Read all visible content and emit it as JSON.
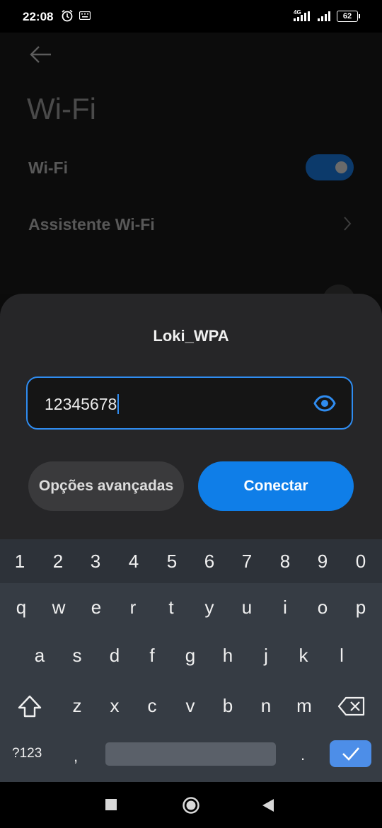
{
  "status_bar": {
    "time": "22:08",
    "network": "4G",
    "battery": "62",
    "icons": [
      "alarm-icon",
      "keyboard-icon",
      "signal-icon",
      "signal-icon",
      "battery-icon"
    ]
  },
  "settings": {
    "title": "Wi-Fi",
    "wifi_label": "Wi-Fi",
    "wifi_enabled": true,
    "assistant_label": "Assistente Wi-Fi"
  },
  "dialog": {
    "network_name": "Loki_WPA",
    "password_value": "12345678",
    "advanced_label": "Opções avançadas",
    "connect_label": "Conectar"
  },
  "keyboard": {
    "numbers": [
      "1",
      "2",
      "3",
      "4",
      "5",
      "6",
      "7",
      "8",
      "9",
      "0"
    ],
    "row1": [
      "q",
      "w",
      "e",
      "r",
      "t",
      "y",
      "u",
      "i",
      "o",
      "p"
    ],
    "row2": [
      "a",
      "s",
      "d",
      "f",
      "g",
      "h",
      "j",
      "k",
      "l"
    ],
    "row3": [
      "z",
      "x",
      "c",
      "v",
      "b",
      "n",
      "m"
    ],
    "symbols_label": "?123",
    "comma": ",",
    "period": "."
  },
  "nav": {
    "icons": [
      "recents-icon",
      "home-icon",
      "back-icon"
    ]
  },
  "colors": {
    "accent": "#0f7ee8",
    "field_border": "#2f8cf0",
    "sheet": "#262628",
    "keyboard": "#363c44"
  }
}
